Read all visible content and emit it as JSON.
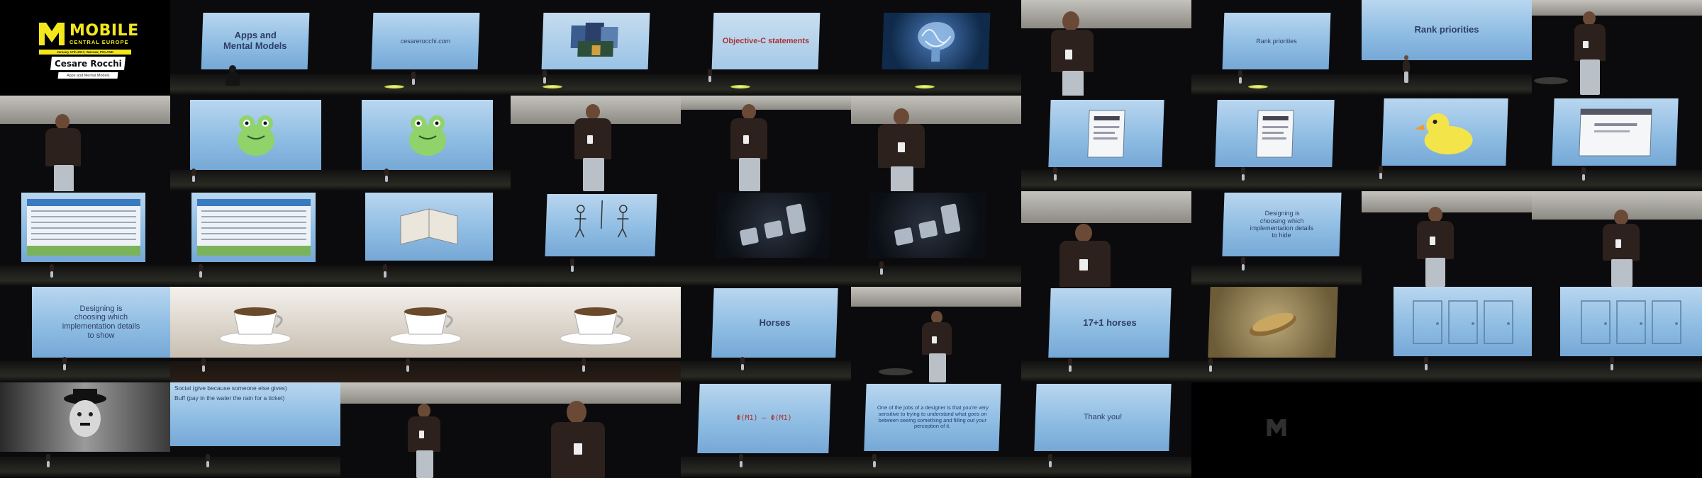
{
  "event": {
    "name": "MOBILE",
    "subtitle": "CENTRAL EUROPE",
    "date_line": "January 17th 2017, Warsaw, POLAND",
    "speaker": "Cesare Rocchi",
    "talk_title": "Apps and Mental Models"
  },
  "slides": {
    "apps_mental_models": "Apps and\nMental Models",
    "url": "cesarerocchi.com",
    "objc": "Objective-C statements",
    "rank1": "Rank priorities",
    "rank2": "Rank priorities",
    "design_hide": "Designing is\nchoosing which\nimplementation details\nto hide",
    "design_show": "Designing is\nchoosing which\nimplementation details\nto show",
    "horses": "Horses",
    "horses_sum": "17+1 horses",
    "social_line": "Social (give because someone else gives)",
    "buff_line": "Buff (pay in the water the rain for a ticket)",
    "equation": "Φ(M1) — Φ(M1)",
    "quote": "One of the jobs of a designer is that you're very sensitive to trying to understand what goes on between seeing something and filling out your perception of it.",
    "thanks": "Thank you!"
  },
  "colors": {
    "brand_yellow": "#f4e81c",
    "slide_blue": "#8fbde3",
    "stage_light": "#e8f56a"
  },
  "icons": [
    "frog-illustration",
    "duck-illustration",
    "brain-illustration",
    "book-illustration",
    "teacup-illustration",
    "pedals-illustration",
    "stick-figures-illustration",
    "charlie-chaplin-illustration",
    "door-illustration",
    "coin-illustration"
  ]
}
